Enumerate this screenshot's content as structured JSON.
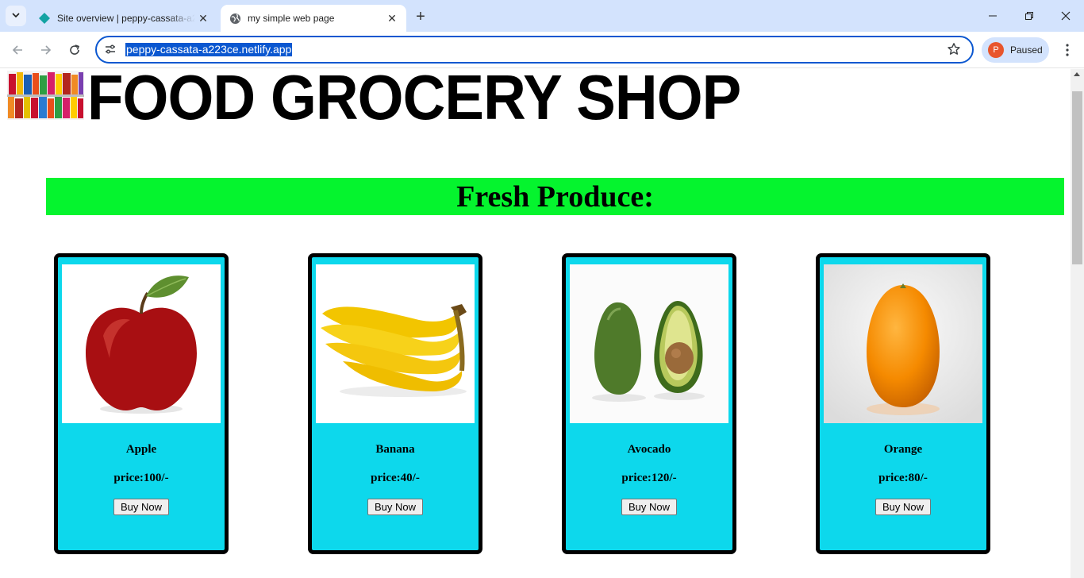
{
  "browser": {
    "tabs": [
      {
        "title": "Site overview | peppy-cassata-a223ce",
        "favicon": "netlify-diamond-icon",
        "active": false
      },
      {
        "title": "my simple web page",
        "favicon": "globe-icon",
        "active": true
      }
    ],
    "url": "peppy-cassata-a223ce.netlify.app",
    "profile": {
      "initial": "P",
      "status": "Paused",
      "color": "#e8552c"
    },
    "accent": "#0b57d0"
  },
  "page": {
    "header": {
      "title": "FOOD GROCERY SHOP",
      "logo": "grocery-shelf-image"
    },
    "section": {
      "title": "Fresh Produce:",
      "color": "#05f42e"
    },
    "card_color": "#0dd8ec",
    "products": [
      {
        "name": "Apple",
        "price": "price:100/-",
        "button": "Buy Now",
        "image": "apple-image"
      },
      {
        "name": "Banana",
        "price": "price:40/-",
        "button": "Buy Now",
        "image": "banana-image"
      },
      {
        "name": "Avocado",
        "price": "price:120/-",
        "button": "Buy Now",
        "image": "avocado-image"
      },
      {
        "name": "Orange",
        "price": "price:80/-",
        "button": "Buy Now",
        "image": "orange-image"
      }
    ]
  }
}
